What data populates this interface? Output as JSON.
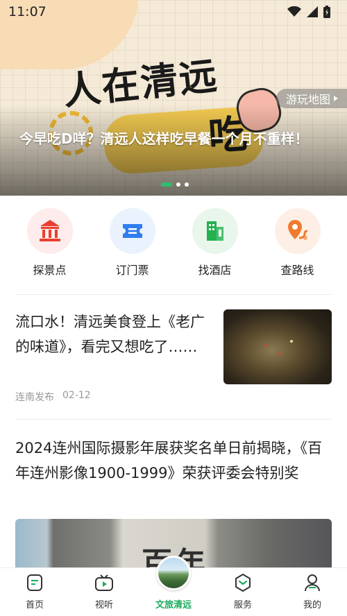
{
  "status_bar": {
    "time": "11:07"
  },
  "banner": {
    "art_title_line1": "人在清远",
    "art_title_line2": "吃",
    "caption": "今早吃D咩？清远人这样吃早餐一个月不重样！",
    "map_link": "游玩地图",
    "active_dot": 0,
    "dot_count": 3
  },
  "quick_actions": [
    {
      "label": "探景点",
      "icon": "landmark-icon",
      "color": "#e8402f",
      "bg": "#fdeceb"
    },
    {
      "label": "订门票",
      "icon": "ticket-icon",
      "color": "#2f7ef0",
      "bg": "#eaf2fd"
    },
    {
      "label": "找酒店",
      "icon": "hotel-icon",
      "color": "#24b14f",
      "bg": "#e8f6ec"
    },
    {
      "label": "查路线",
      "icon": "route-pin-icon",
      "color": "#f07a2d",
      "bg": "#fdefe5"
    }
  ],
  "articles": [
    {
      "title": "流口水！清远美食登上《老广的味道》，看完又想吃了……",
      "source": "连南发布",
      "date": "02-12"
    },
    {
      "title": "2024连州国际摄影年展获奖名单日前揭晓，《百年连州影像1900-1999》荣获评委会特别奖",
      "image_text": "百年"
    }
  ],
  "tabs": [
    {
      "label": "首页",
      "icon": "home-doc-icon"
    },
    {
      "label": "视听",
      "icon": "tv-play-icon"
    },
    {
      "label": "文旅清远",
      "icon": "landscape-avatar-icon",
      "active": true
    },
    {
      "label": "服务",
      "icon": "service-shield-icon"
    },
    {
      "label": "我的",
      "icon": "profile-icon"
    }
  ],
  "colors": {
    "accent": "#1aab5a",
    "active_dot": "#2bbf71"
  }
}
